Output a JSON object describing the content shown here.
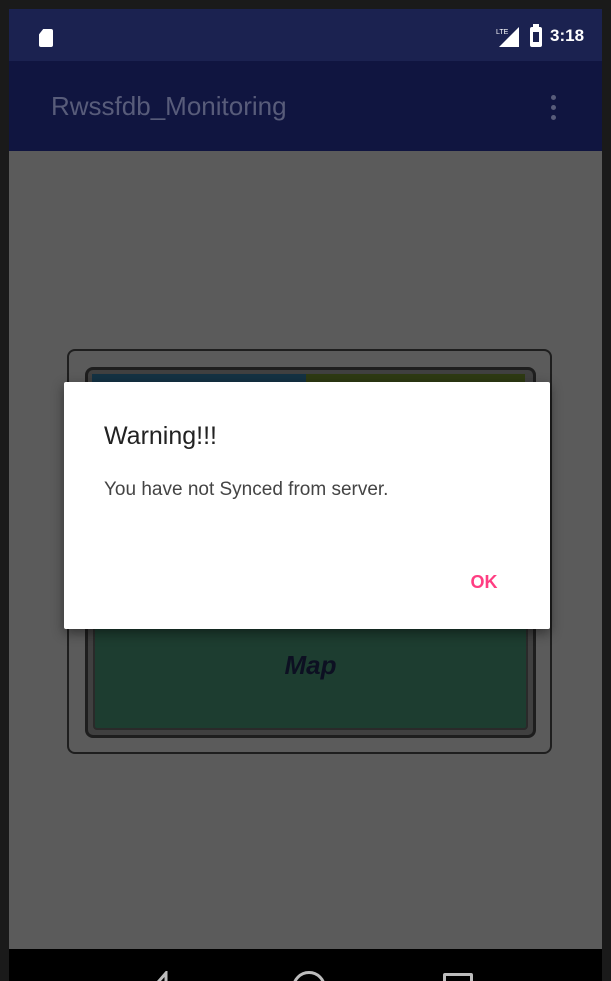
{
  "status_bar": {
    "time": "3:18",
    "icons": [
      "sd-card-icon",
      "signal-icon",
      "battery-icon"
    ]
  },
  "app_bar": {
    "title": "Rwssfdb_Monitoring",
    "menu_icon": "overflow-menu-icon"
  },
  "background_screen": {
    "map_label": "Map"
  },
  "dialog": {
    "title": "Warning!!!",
    "message": "You have not Synced from server.",
    "ok_label": "OK"
  },
  "nav_bar": {
    "icons": [
      "back-icon",
      "home-icon",
      "recents-icon"
    ]
  },
  "colors": {
    "status_bar": "#1b2250",
    "app_bar": "#101540",
    "accent": "#ff3d82",
    "scrim": "#5b5b5b"
  }
}
